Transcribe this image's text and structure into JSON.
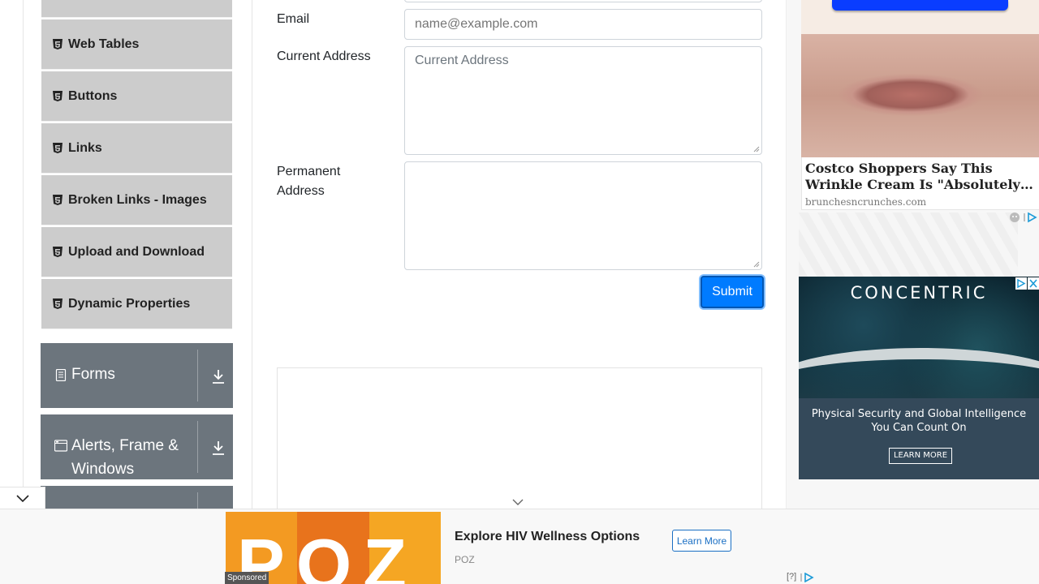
{
  "sidebar": {
    "top_partial_item": "",
    "items": [
      {
        "label": "Web Tables"
      },
      {
        "label": "Buttons"
      },
      {
        "label": "Links"
      },
      {
        "label": "Broken Links - Images"
      },
      {
        "label": "Upload and Download"
      },
      {
        "label": "Dynamic Properties"
      }
    ],
    "groups": [
      {
        "label": "Forms",
        "icon": "form-icon"
      },
      {
        "label": "Alerts, Frame & Windows",
        "icon": "window-icon"
      }
    ]
  },
  "form": {
    "email_label": "Email",
    "email_placeholder": "name@example.com",
    "current_address_label": "Current Address",
    "current_address_placeholder": "Current Address",
    "permanent_address_label": "Permanent Address",
    "permanent_address_value": "",
    "submit_label": "Submit"
  },
  "ads": {
    "native": {
      "title": "Costco Shoppers Say This Wrinkle Cream Is \"Absolutely…",
      "source": "brunchesncrunches.com"
    },
    "banner": {
      "brand": "CONCENTRIC",
      "tagline": "Physical Security and Global Intelligence You Can Count On",
      "cta": "LEARN MORE"
    },
    "bottom": {
      "image_text": "POZ",
      "badge": "Sponsored",
      "title": "Explore HIV Wellness Options",
      "source": "POZ",
      "cta": "Learn More",
      "help": "[?]"
    }
  },
  "colors": {
    "menu_item_bg": "#cccccc",
    "group_bg": "#6c757d",
    "submit_bg": "#007bff",
    "poz_orange": "#e8731c"
  }
}
